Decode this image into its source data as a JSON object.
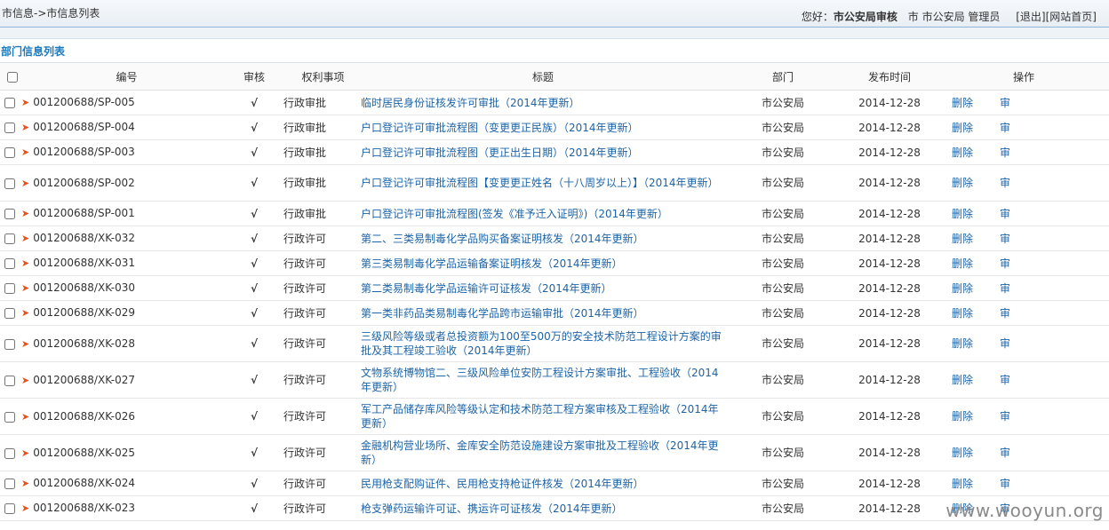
{
  "header": {
    "breadcrumb": "市信息->市信息列表",
    "greeting": "您好：",
    "role": "市公安局审核",
    "city": "市",
    "dept_user": "市公安局 管理员",
    "logout": "[退出]",
    "home": "[网站首页]"
  },
  "section": {
    "title": "部门信息列表"
  },
  "table": {
    "headers": {
      "code": "编号",
      "review": "审核",
      "type": "权利事项",
      "title": "标题",
      "dept": "部门",
      "date": "发布时间",
      "ops": "操作"
    },
    "check_mark": "√",
    "delete_label": "删除",
    "audit_label": "审",
    "rows": [
      {
        "code": "001200688/SP-005",
        "type": "行政审批",
        "title": "临时居民身份证核发许可审批（2014年更新）",
        "dept": "市公安局",
        "date": "2014-12-28"
      },
      {
        "code": "001200688/SP-004",
        "type": "行政审批",
        "title": "户口登记许可审批流程图（变更更正民族）（2014年更新）",
        "dept": "市公安局",
        "date": "2014-12-28"
      },
      {
        "code": "001200688/SP-003",
        "type": "行政审批",
        "title": "户口登记许可审批流程图（更正出生日期）（2014年更新）",
        "dept": "市公安局",
        "date": "2014-12-28"
      },
      {
        "code": "001200688/SP-002",
        "type": "行政审批",
        "title": "户口登记许可审批流程图【变更更正姓名（十八周岁以上）】（2014年更新）",
        "dept": "市公安局",
        "date": "2014-12-28"
      },
      {
        "code": "001200688/SP-001",
        "type": "行政审批",
        "title": "户口登记许可审批流程图(签发《准予迁入证明》)（2014年更新）",
        "dept": "市公安局",
        "date": "2014-12-28"
      },
      {
        "code": "001200688/XK-032",
        "type": "行政许可",
        "title": "第二、三类易制毒化学品购买备案证明核发（2014年更新）",
        "dept": "市公安局",
        "date": "2014-12-28"
      },
      {
        "code": "001200688/XK-031",
        "type": "行政许可",
        "title": "第三类易制毒化学品运输备案证明核发（2014年更新）",
        "dept": "市公安局",
        "date": "2014-12-28"
      },
      {
        "code": "001200688/XK-030",
        "type": "行政许可",
        "title": "第二类易制毒化学品运输许可证核发（2014年更新）",
        "dept": "市公安局",
        "date": "2014-12-28"
      },
      {
        "code": "001200688/XK-029",
        "type": "行政许可",
        "title": "第一类非药品类易制毒化学品跨市运输审批（2014年更新）",
        "dept": "市公安局",
        "date": "2014-12-28"
      },
      {
        "code": "001200688/XK-028",
        "type": "行政许可",
        "title": "三级风险等级或者总投资额为100至500万的安全技术防范工程设计方案的审批及其工程竣工验收（2014年更新）",
        "dept": "市公安局",
        "date": "2014-12-28"
      },
      {
        "code": "001200688/XK-027",
        "type": "行政许可",
        "title": "文物系统博物馆二、三级风险单位安防工程设计方案审批、工程验收（2014年更新）",
        "dept": "市公安局",
        "date": "2014-12-28"
      },
      {
        "code": "001200688/XK-026",
        "type": "行政许可",
        "title": "军工产品储存库风险等级认定和技术防范工程方案审核及工程验收（2014年更新）",
        "dept": "市公安局",
        "date": "2014-12-28"
      },
      {
        "code": "001200688/XK-025",
        "type": "行政许可",
        "title": "金融机构营业场所、金库安全防范设施建设方案审批及工程验收（2014年更新）",
        "dept": "市公安局",
        "date": "2014-12-28"
      },
      {
        "code": "001200688/XK-024",
        "type": "行政许可",
        "title": "民用枪支配购证件、民用枪支持枪证件核发（2014年更新）",
        "dept": "市公安局",
        "date": "2014-12-28"
      },
      {
        "code": "001200688/XK-023",
        "type": "行政许可",
        "title": "枪支弹药运输许可证、携运许可证核发（2014年更新）",
        "dept": "市公安局",
        "date": "2014-12-28"
      }
    ]
  },
  "watermark": "www.wooyun.org"
}
